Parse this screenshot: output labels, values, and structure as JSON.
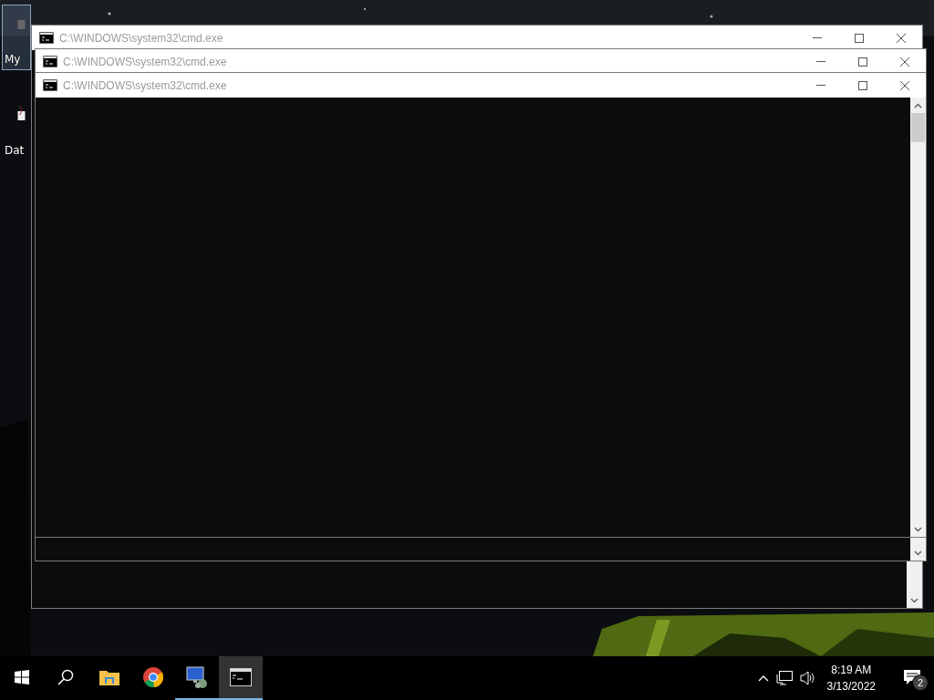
{
  "desktop_icons": [
    {
      "label": "My",
      "selected": true
    },
    {
      "label": "Dat",
      "selected": false
    }
  ],
  "windows": [
    {
      "title": "C:\\WINDOWS\\system32\\cmd.exe"
    },
    {
      "title": "C:\\WINDOWS\\system32\\cmd.exe"
    },
    {
      "title": "C:\\WINDOWS\\system32\\cmd.exe"
    }
  ],
  "taskbar": {
    "apps": [
      {
        "kind": "folder",
        "running": false,
        "active": false
      },
      {
        "kind": "browser",
        "running": false,
        "active": false
      },
      {
        "kind": "remote",
        "running": true,
        "active": false
      },
      {
        "kind": "terminal",
        "running": true,
        "active": true
      }
    ],
    "clock": {
      "time": "8:19 AM",
      "date": "3/13/2022"
    },
    "notifications": {
      "count": "2"
    }
  }
}
